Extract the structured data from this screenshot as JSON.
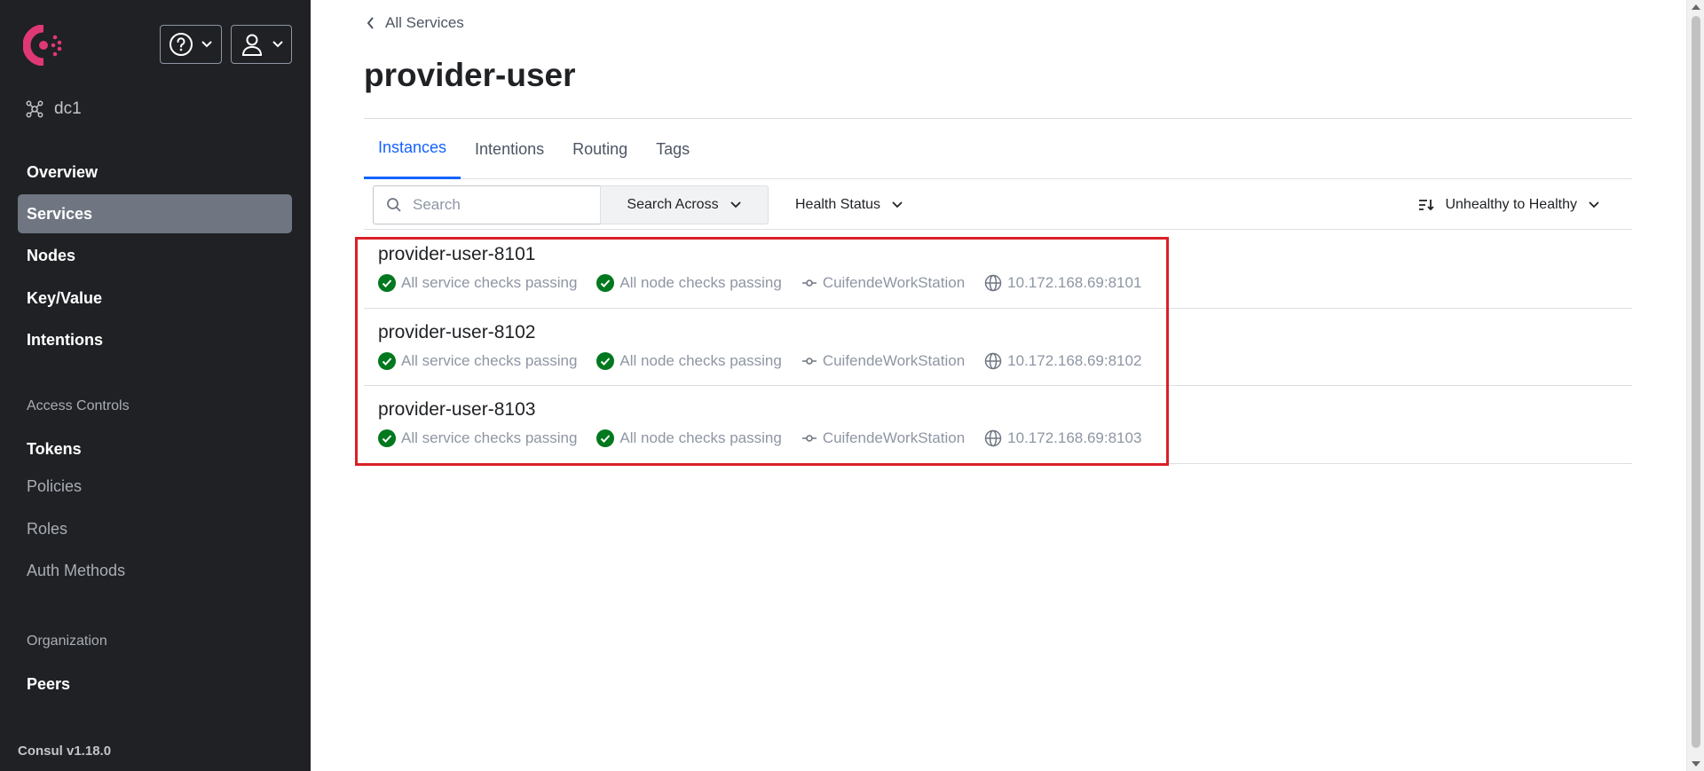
{
  "sidebar": {
    "datacenter": "dc1",
    "nav": {
      "overview": "Overview",
      "services": "Services",
      "nodes": "Nodes",
      "key_value": "Key/Value",
      "intentions": "Intentions"
    },
    "access_controls": {
      "heading": "Access Controls",
      "tokens": "Tokens",
      "policies": "Policies",
      "roles": "Roles",
      "auth_methods": "Auth Methods"
    },
    "organization": {
      "heading": "Organization",
      "peers": "Peers"
    },
    "version": "Consul v1.18.0"
  },
  "header": {
    "breadcrumb": "All Services",
    "title": "provider-user"
  },
  "tabs": [
    "Instances",
    "Intentions",
    "Routing",
    "Tags"
  ],
  "toolbar": {
    "search_placeholder": "Search",
    "search_across": "Search Across",
    "health_status": "Health Status",
    "sort": "Unhealthy to Healthy"
  },
  "instances": [
    {
      "name": "provider-user-8101",
      "service_checks": "All service checks passing",
      "node_checks": "All node checks passing",
      "node": "CuifendeWorkStation",
      "address": "10.172.168.69:8101"
    },
    {
      "name": "provider-user-8102",
      "service_checks": "All service checks passing",
      "node_checks": "All node checks passing",
      "node": "CuifendeWorkStation",
      "address": "10.172.168.69:8102"
    },
    {
      "name": "provider-user-8103",
      "service_checks": "All service checks passing",
      "node_checks": "All node checks passing",
      "node": "CuifendeWorkStation",
      "address": "10.172.168.69:8103"
    }
  ],
  "colors": {
    "brand": "#e03875",
    "accent": "#1563ff",
    "passing": "#00781e",
    "highlight": "#d92027"
  }
}
